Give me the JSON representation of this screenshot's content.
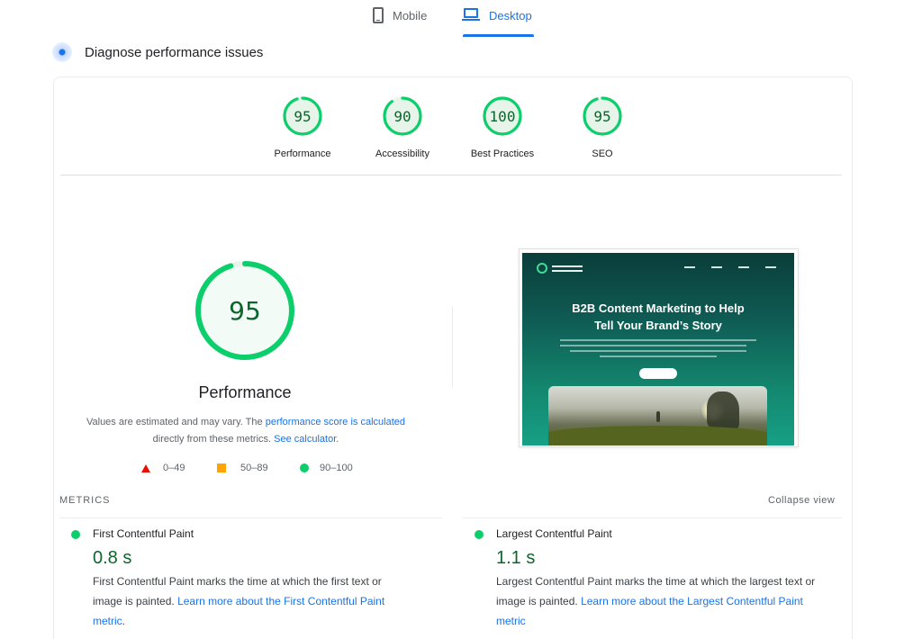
{
  "tabs": {
    "mobile": {
      "label": "Mobile",
      "icon": "phone-icon"
    },
    "desktop": {
      "label": "Desktop",
      "icon": "laptop-icon",
      "active": true
    }
  },
  "diagnose": {
    "title": "Diagnose performance issues"
  },
  "scores": [
    {
      "label": "Performance",
      "value": "95",
      "fraction": 0.95
    },
    {
      "label": "Accessibility",
      "value": "90",
      "fraction": 0.9
    },
    {
      "label": "Best Practices",
      "value": "100",
      "fraction": 1.0
    },
    {
      "label": "SEO",
      "value": "95",
      "fraction": 0.95
    }
  ],
  "performance": {
    "score": "95",
    "fraction": 0.95,
    "title": "Performance",
    "desc_prefix": "Values are estimated and may vary. The ",
    "desc_link1": "performance score is calculated",
    "desc_middle": " directly from these metrics. ",
    "desc_link2": "See calculator",
    "desc_suffix": "."
  },
  "legend": {
    "fail": "0–49",
    "average": "50–89",
    "pass": "90–100"
  },
  "thumbnail": {
    "headline_line1": "B2B Content Marketing to Help",
    "headline_line2": "Tell Your Brand’s Story"
  },
  "metrics": {
    "heading": "METRICS",
    "collapse_label": "Collapse view",
    "fcp": {
      "name": "First Contentful Paint",
      "value": "0.8 s",
      "desc": "First Contentful Paint marks the time at which the first text or image is painted. ",
      "link": "Learn more about the First Contentful Paint metric"
    },
    "lcp": {
      "name": "Largest Contentful Paint",
      "value": "1.1 s",
      "desc": "Largest Contentful Paint marks the time at which the largest text or image is painted. ",
      "link": "Learn more about the Largest Contentful Paint metric"
    }
  },
  "colors": {
    "pass": "#0cce6b",
    "pass_text": "#0d652d",
    "pass_bg": "#e6f4ea",
    "average": "#ffa400",
    "fail": "#eb0f00",
    "accent": "#1a73e8"
  }
}
